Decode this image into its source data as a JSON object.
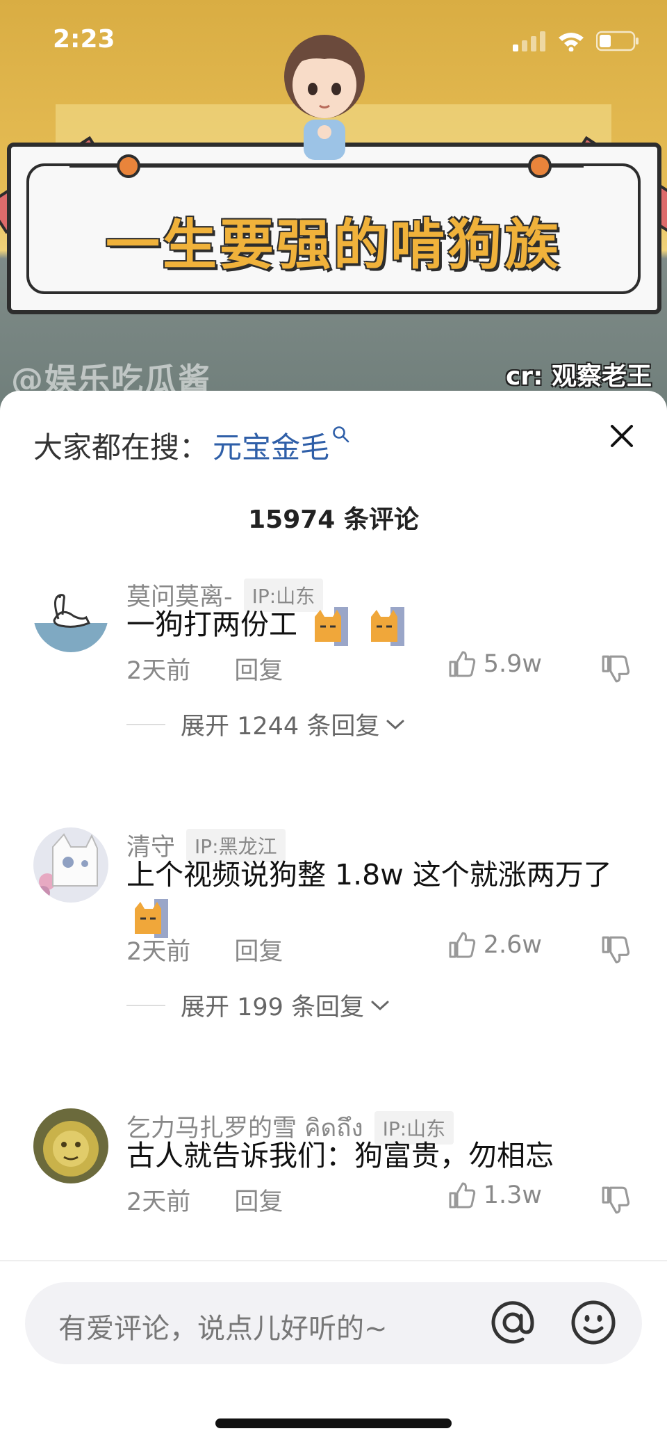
{
  "status_bar": {
    "time": "2:23"
  },
  "video": {
    "title": "一生要强的啃狗族",
    "watermark": "@娱乐吃瓜酱",
    "credit": "cr: 观察老王"
  },
  "search_bar": {
    "label": "大家都在搜：",
    "keyword": "元宝金毛"
  },
  "comments_header": {
    "count": "15974 条评论"
  },
  "comments": [
    {
      "username": "莫问莫离-",
      "ip": "IP:山东",
      "text": "一狗打两份工",
      "emoji_count": 2,
      "time": "2天前",
      "reply_label": "回复",
      "likes": "5.9w",
      "expand": "展开 1244 条回复"
    },
    {
      "username": "清守",
      "ip": "IP:黑龙江",
      "text": "上个视频说狗整 1.8w 这个就涨两万了",
      "emoji_count": 1,
      "time": "2天前",
      "reply_label": "回复",
      "likes": "2.6w",
      "expand": "展开 199 条回复"
    },
    {
      "username": "乞力马扎罗的雪 คิดถึง",
      "ip": "IP:山东",
      "text": "古人就告诉我们：狗富贵，勿相忘",
      "emoji_count": 0,
      "time": "2天前",
      "reply_label": "回复",
      "likes": "1.3w"
    }
  ],
  "input": {
    "placeholder": "有爱评论，说点儿好听的~"
  },
  "icons": {
    "search": "search-icon",
    "close": "close-icon",
    "like": "thumbs-up-icon",
    "dislike": "thumbs-down-icon",
    "mention": "at-icon",
    "emoji": "smile-icon"
  },
  "colors": {
    "keyword": "#2f5fa8",
    "banner": "#e6bd55"
  }
}
